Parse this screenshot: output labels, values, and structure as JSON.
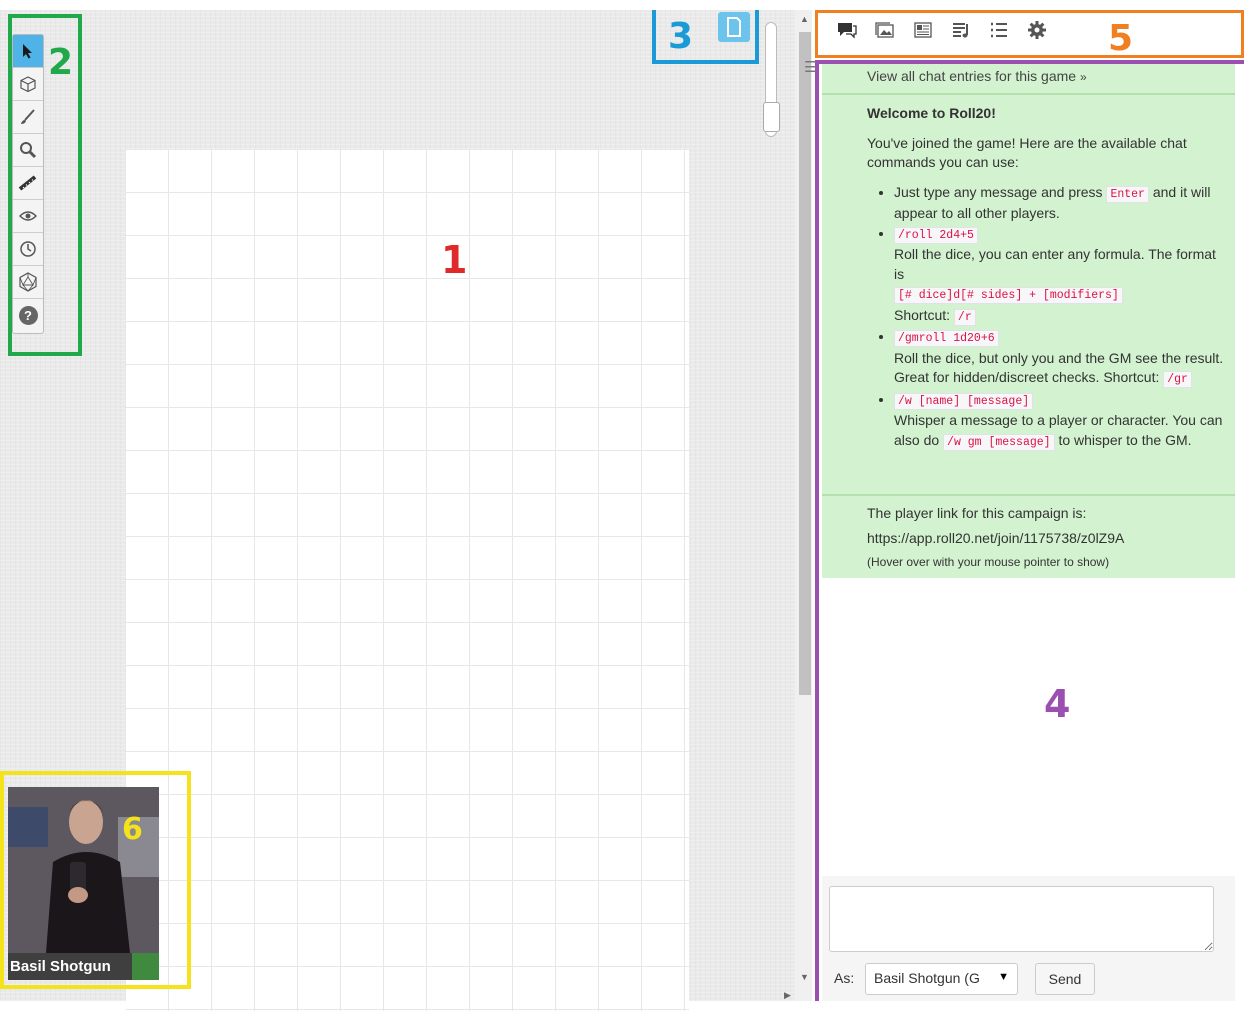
{
  "annotations": {
    "canvas": "1",
    "toolbar": "2",
    "page_toolbar": "3",
    "chat": "4",
    "tabs": "5",
    "player": "6"
  },
  "colors": {
    "annotation_canvas": "#e02a2a",
    "annotation_toolbar": "#21a84a",
    "annotation_page_toolbar": "#1a9ad6",
    "annotation_chat": "#9b4fb0",
    "annotation_tabs": "#f07f22",
    "annotation_player": "#f4e21a",
    "chat_background": "#d3f2d0",
    "active_tool": "#4fb3e8"
  },
  "toolbar": {
    "tools": [
      "select-tool-icon",
      "layers-tool-icon",
      "draw-tool-icon",
      "zoom-tool-icon",
      "measure-tool-icon",
      "fog-of-war-tool-icon",
      "turn-tracker-tool-icon",
      "dice-tool-icon",
      "help-tool-icon"
    ],
    "help_glyph": "?"
  },
  "tabs": [
    "chat-tab-icon",
    "art-library-tab-icon",
    "journal-tab-icon",
    "jukebox-tab-icon",
    "collections-tab-icon",
    "settings-tab-icon"
  ],
  "chat": {
    "view_all": "View all chat entries for this game",
    "view_all_suffix": "»",
    "welcome_title": "Welcome to Roll20!",
    "welcome_intro": "You've joined the game! Here are the available chat commands you can use:",
    "cmd1_text_a": "Just type any message and press",
    "cmd1_code": "Enter",
    "cmd1_text_b": "and it will appear to all other players.",
    "cmd2_code": "/roll 2d4+5",
    "cmd2_text": "Roll the dice, you can enter any formula. The format is",
    "cmd2_format": "[# dice]d[# sides] + [modifiers]",
    "cmd2_shortcut_label": "Shortcut:",
    "cmd2_shortcut": "/r",
    "cmd3_code": "/gmroll 1d20+6",
    "cmd3_text": "Roll the dice, but only you and the GM see the result. Great for hidden/discreet checks. Shortcut:",
    "cmd3_shortcut": "/gr",
    "cmd4_code": "/w [name] [message]",
    "cmd4_text_a": "Whisper a message to a player or character. You can also do",
    "cmd4_code2": "/w gm [message]",
    "cmd4_text_b": "to whisper to the GM.",
    "player_link_label": "The player link for this campaign is:",
    "player_link": "https://app.roll20.net/join/1175738/z0lZ9A",
    "player_link_note": "(Hover over with your mouse pointer to show)"
  },
  "chat_input": {
    "value": "",
    "as_label": "As:",
    "speaking_as": "Basil Shotgun (G",
    "send_label": "Send"
  },
  "player": {
    "name": "Basil Shotgun"
  }
}
